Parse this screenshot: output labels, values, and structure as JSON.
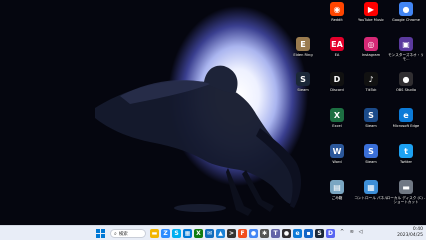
{
  "desktop": {
    "icons": [
      {
        "label": "Reddit",
        "glyph": "◉",
        "color": "#ff4500"
      },
      {
        "label": "YouTube Music",
        "glyph": "▶",
        "color": "#ff0000"
      },
      {
        "label": "Google Chrome",
        "glyph": "●",
        "color": "#4285f4"
      },
      {
        "label": "EA",
        "glyph": "EA",
        "color": "#e4002b"
      },
      {
        "label": "Instagram",
        "glyph": "◎",
        "color": "#d62976"
      },
      {
        "label": "モンスターズネオ・リモ...",
        "glyph": "▣",
        "color": "#5b3a9e"
      },
      {
        "label": "Elden Ring",
        "glyph": "E",
        "color": "#9a7b4f"
      },
      {
        "label": "Discord",
        "glyph": "D",
        "color": "#111111"
      },
      {
        "label": "TikTok",
        "glyph": "♪",
        "color": "#111111"
      },
      {
        "label": "OBS Studio",
        "glyph": "●",
        "color": "#302e31"
      },
      {
        "label": "Steam",
        "glyph": "S",
        "color": "#1b2838"
      },
      {
        "label": "Excel",
        "glyph": "X",
        "color": "#1d6f42"
      },
      {
        "label": "Steam",
        "glyph": "S",
        "color": "#1b4b8a"
      },
      {
        "label": "Microsoft Edge",
        "glyph": "e",
        "color": "#0c7bd8"
      },
      {
        "label": "Word",
        "glyph": "W",
        "color": "#2b579a"
      },
      {
        "label": "Steam",
        "glyph": "S",
        "color": "#3a6fd8"
      },
      {
        "label": "Twitter",
        "glyph": "t",
        "color": "#1da1f2"
      },
      {
        "label": "ごみ箱",
        "glyph": "▤",
        "color": "#7aa6c2"
      },
      {
        "label": "コントロール パネル",
        "glyph": "▦",
        "color": "#3d8fd8"
      },
      {
        "label": "ローカル ディスク (C) - ショートカット",
        "glyph": "▬",
        "color": "#707884"
      }
    ]
  },
  "taskbar": {
    "search_label": "検索",
    "start_icon": "windows-start",
    "apps": [
      {
        "name": "file-explorer",
        "glyph": "▬",
        "color": "#f2b600"
      },
      {
        "name": "zoom",
        "glyph": "Z",
        "color": "#2d8cff"
      },
      {
        "name": "skype",
        "glyph": "S",
        "color": "#00aff0"
      },
      {
        "name": "store",
        "glyph": "▦",
        "color": "#0078d4"
      },
      {
        "name": "xbox",
        "glyph": "X",
        "color": "#107c10"
      },
      {
        "name": "mail",
        "glyph": "✉",
        "color": "#0f6cbd"
      },
      {
        "name": "photos",
        "glyph": "▲",
        "color": "#1b82d8"
      },
      {
        "name": "terminal",
        "glyph": ">",
        "color": "#333333"
      },
      {
        "name": "figma",
        "glyph": "F",
        "color": "#f24e1e"
      },
      {
        "name": "chrome",
        "glyph": "●",
        "color": "#4285f4"
      },
      {
        "name": "settings",
        "glyph": "✱",
        "color": "#555555"
      },
      {
        "name": "teams",
        "glyph": "T",
        "color": "#6264a7"
      },
      {
        "name": "obs",
        "glyph": "●",
        "color": "#302e31"
      },
      {
        "name": "edge",
        "glyph": "e",
        "color": "#0c7bd8"
      },
      {
        "name": "app-blue",
        "glyph": "▪",
        "color": "#1366c6"
      },
      {
        "name": "steam",
        "glyph": "S",
        "color": "#1b2838"
      },
      {
        "name": "discord",
        "glyph": "D",
        "color": "#5865f2"
      }
    ],
    "clock_time": "0:40",
    "clock_date": "2023/04/25"
  }
}
